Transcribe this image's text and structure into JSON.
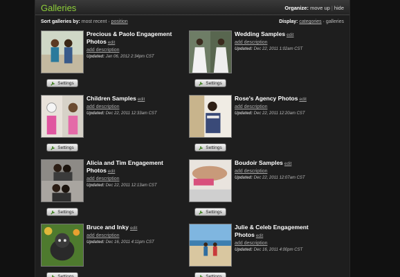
{
  "header": {
    "title": "Galleries",
    "organize_label": "Organize:",
    "move_up": "move up",
    "hide": "hide"
  },
  "sort": {
    "label": "Sort galleries by:",
    "recent": "most recent",
    "position": "position"
  },
  "display": {
    "label": "Display:",
    "categories": "categories",
    "galleries": "galleries"
  },
  "common": {
    "edit": "edit",
    "add_description": "add description",
    "settings": "Settings",
    "updated_prefix": "Updated:"
  },
  "galleries": [
    {
      "name": "Precious & Paolo Engagement Photos",
      "updated": "Jan 06, 2012 2:34pm CST"
    },
    {
      "name": "Wedding Samples",
      "updated": "Dec 22, 2011 1:02am CST"
    },
    {
      "name": "Children Samples",
      "updated": "Dec 22, 2011 12:33am CST"
    },
    {
      "name": "Rose's Agency Photos",
      "updated": "Dec 22, 2011 12:20am CST"
    },
    {
      "name": "Alicia and Tim Engagement Photos",
      "updated": "Dec 22, 2011 12:13am CST"
    },
    {
      "name": "Boudoir Samples",
      "updated": "Dec 22, 2011 12:07am CST"
    },
    {
      "name": "Bruce and Inky",
      "updated": "Dec 16, 2011 4:11pm CST"
    },
    {
      "name": "Julie & Celeb Engagement Photos",
      "updated": "Dec 16, 2011 4:00pm CST"
    }
  ]
}
